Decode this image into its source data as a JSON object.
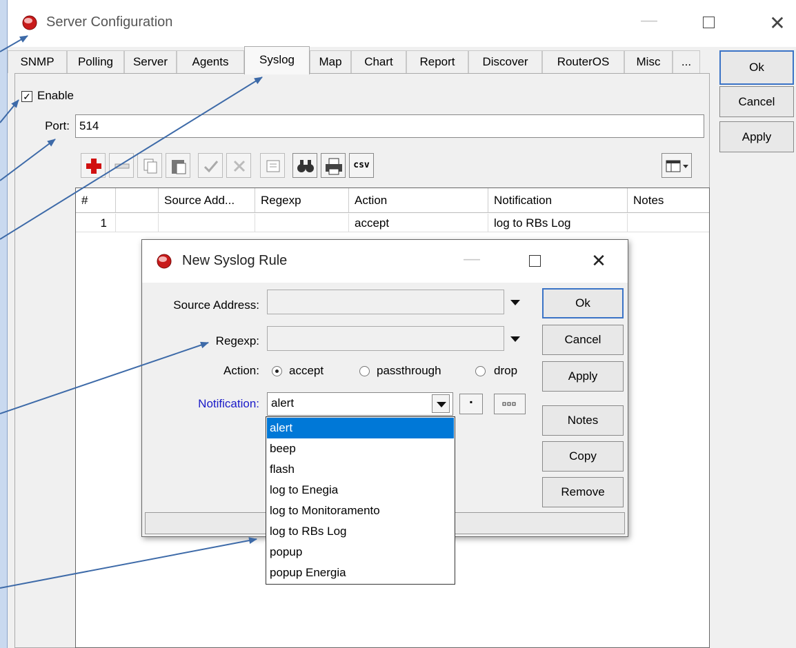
{
  "window": {
    "title": "Server Configuration",
    "tabs": [
      "SNMP",
      "Polling",
      "Server",
      "Agents",
      "Syslog",
      "Map",
      "Chart",
      "Report",
      "Discover",
      "RouterOS",
      "Misc",
      "..."
    ],
    "active_tab": "Syslog",
    "buttons": {
      "ok": "Ok",
      "cancel": "Cancel",
      "apply": "Apply"
    }
  },
  "syslog": {
    "enable_label": "Enable",
    "enable_checked": true,
    "port_label": "Port:",
    "port_value": "514",
    "toolbar": [
      "add-icon",
      "remove-icon",
      "copy-icon",
      "paste-icon",
      "enable-icon",
      "disable-icon",
      "comment-icon",
      "find-icon",
      "print-icon",
      "csv-icon",
      "columns-icon"
    ],
    "csv_label": "csv",
    "table": {
      "columns": [
        "#",
        "",
        "Source Add...",
        "Regexp",
        "Action",
        "Notification",
        "Notes"
      ],
      "rows": [
        [
          "1",
          "",
          "",
          "",
          "accept",
          "log to RBs Log",
          ""
        ]
      ]
    }
  },
  "dialog": {
    "title": "New Syslog Rule",
    "source_address_label": "Source Address:",
    "source_address_value": "",
    "regexp_label": "Regexp:",
    "regexp_value": "",
    "action_label": "Action:",
    "actions": [
      "accept",
      "passthrough",
      "drop"
    ],
    "action_selected": "accept",
    "notification_label": "Notification:",
    "notification_value": "alert",
    "notification_label_color": "#1a1ac8",
    "notification_options": [
      "alert",
      "beep",
      "flash",
      "log to Enegia",
      "log to Monitoramento",
      "log to RBs Log",
      "popup",
      "popup Energia"
    ],
    "buttons": {
      "ok": "Ok",
      "cancel": "Cancel",
      "apply": "Apply",
      "notes": "Notes",
      "copy": "Copy",
      "remove": "Remove"
    }
  },
  "colors": {
    "background": "#c9d9ef",
    "arrow": "#3d6aa8",
    "selection": "#0078d7",
    "add_icon": "#d01010"
  }
}
